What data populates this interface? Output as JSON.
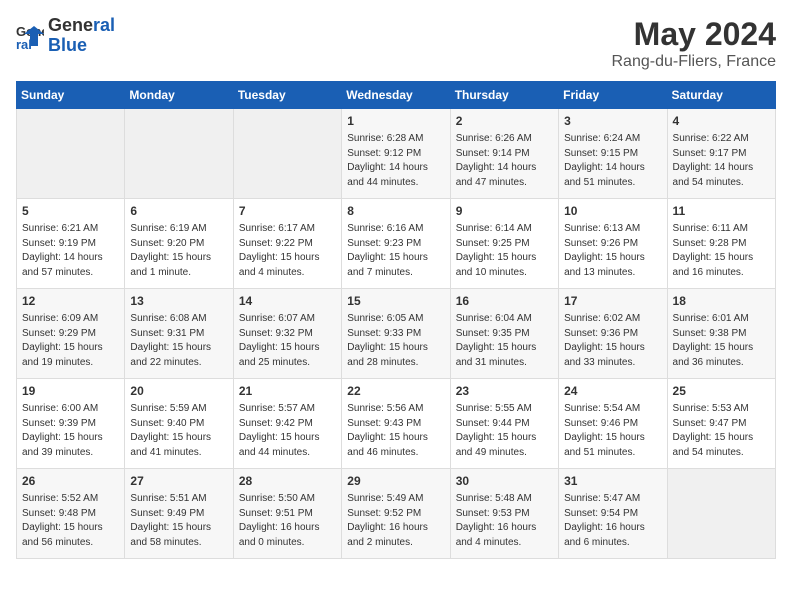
{
  "logo": {
    "line1": "General",
    "line2": "Blue"
  },
  "header": {
    "month": "May 2024",
    "location": "Rang-du-Fliers, France"
  },
  "days_of_week": [
    "Sunday",
    "Monday",
    "Tuesday",
    "Wednesday",
    "Thursday",
    "Friday",
    "Saturday"
  ],
  "weeks": [
    [
      {
        "day": "",
        "info": ""
      },
      {
        "day": "",
        "info": ""
      },
      {
        "day": "",
        "info": ""
      },
      {
        "day": "1",
        "info": "Sunrise: 6:28 AM\nSunset: 9:12 PM\nDaylight: 14 hours\nand 44 minutes."
      },
      {
        "day": "2",
        "info": "Sunrise: 6:26 AM\nSunset: 9:14 PM\nDaylight: 14 hours\nand 47 minutes."
      },
      {
        "day": "3",
        "info": "Sunrise: 6:24 AM\nSunset: 9:15 PM\nDaylight: 14 hours\nand 51 minutes."
      },
      {
        "day": "4",
        "info": "Sunrise: 6:22 AM\nSunset: 9:17 PM\nDaylight: 14 hours\nand 54 minutes."
      }
    ],
    [
      {
        "day": "5",
        "info": "Sunrise: 6:21 AM\nSunset: 9:19 PM\nDaylight: 14 hours\nand 57 minutes."
      },
      {
        "day": "6",
        "info": "Sunrise: 6:19 AM\nSunset: 9:20 PM\nDaylight: 15 hours\nand 1 minute."
      },
      {
        "day": "7",
        "info": "Sunrise: 6:17 AM\nSunset: 9:22 PM\nDaylight: 15 hours\nand 4 minutes."
      },
      {
        "day": "8",
        "info": "Sunrise: 6:16 AM\nSunset: 9:23 PM\nDaylight: 15 hours\nand 7 minutes."
      },
      {
        "day": "9",
        "info": "Sunrise: 6:14 AM\nSunset: 9:25 PM\nDaylight: 15 hours\nand 10 minutes."
      },
      {
        "day": "10",
        "info": "Sunrise: 6:13 AM\nSunset: 9:26 PM\nDaylight: 15 hours\nand 13 minutes."
      },
      {
        "day": "11",
        "info": "Sunrise: 6:11 AM\nSunset: 9:28 PM\nDaylight: 15 hours\nand 16 minutes."
      }
    ],
    [
      {
        "day": "12",
        "info": "Sunrise: 6:09 AM\nSunset: 9:29 PM\nDaylight: 15 hours\nand 19 minutes."
      },
      {
        "day": "13",
        "info": "Sunrise: 6:08 AM\nSunset: 9:31 PM\nDaylight: 15 hours\nand 22 minutes."
      },
      {
        "day": "14",
        "info": "Sunrise: 6:07 AM\nSunset: 9:32 PM\nDaylight: 15 hours\nand 25 minutes."
      },
      {
        "day": "15",
        "info": "Sunrise: 6:05 AM\nSunset: 9:33 PM\nDaylight: 15 hours\nand 28 minutes."
      },
      {
        "day": "16",
        "info": "Sunrise: 6:04 AM\nSunset: 9:35 PM\nDaylight: 15 hours\nand 31 minutes."
      },
      {
        "day": "17",
        "info": "Sunrise: 6:02 AM\nSunset: 9:36 PM\nDaylight: 15 hours\nand 33 minutes."
      },
      {
        "day": "18",
        "info": "Sunrise: 6:01 AM\nSunset: 9:38 PM\nDaylight: 15 hours\nand 36 minutes."
      }
    ],
    [
      {
        "day": "19",
        "info": "Sunrise: 6:00 AM\nSunset: 9:39 PM\nDaylight: 15 hours\nand 39 minutes."
      },
      {
        "day": "20",
        "info": "Sunrise: 5:59 AM\nSunset: 9:40 PM\nDaylight: 15 hours\nand 41 minutes."
      },
      {
        "day": "21",
        "info": "Sunrise: 5:57 AM\nSunset: 9:42 PM\nDaylight: 15 hours\nand 44 minutes."
      },
      {
        "day": "22",
        "info": "Sunrise: 5:56 AM\nSunset: 9:43 PM\nDaylight: 15 hours\nand 46 minutes."
      },
      {
        "day": "23",
        "info": "Sunrise: 5:55 AM\nSunset: 9:44 PM\nDaylight: 15 hours\nand 49 minutes."
      },
      {
        "day": "24",
        "info": "Sunrise: 5:54 AM\nSunset: 9:46 PM\nDaylight: 15 hours\nand 51 minutes."
      },
      {
        "day": "25",
        "info": "Sunrise: 5:53 AM\nSunset: 9:47 PM\nDaylight: 15 hours\nand 54 minutes."
      }
    ],
    [
      {
        "day": "26",
        "info": "Sunrise: 5:52 AM\nSunset: 9:48 PM\nDaylight: 15 hours\nand 56 minutes."
      },
      {
        "day": "27",
        "info": "Sunrise: 5:51 AM\nSunset: 9:49 PM\nDaylight: 15 hours\nand 58 minutes."
      },
      {
        "day": "28",
        "info": "Sunrise: 5:50 AM\nSunset: 9:51 PM\nDaylight: 16 hours\nand 0 minutes."
      },
      {
        "day": "29",
        "info": "Sunrise: 5:49 AM\nSunset: 9:52 PM\nDaylight: 16 hours\nand 2 minutes."
      },
      {
        "day": "30",
        "info": "Sunrise: 5:48 AM\nSunset: 9:53 PM\nDaylight: 16 hours\nand 4 minutes."
      },
      {
        "day": "31",
        "info": "Sunrise: 5:47 AM\nSunset: 9:54 PM\nDaylight: 16 hours\nand 6 minutes."
      },
      {
        "day": "",
        "info": ""
      }
    ]
  ]
}
